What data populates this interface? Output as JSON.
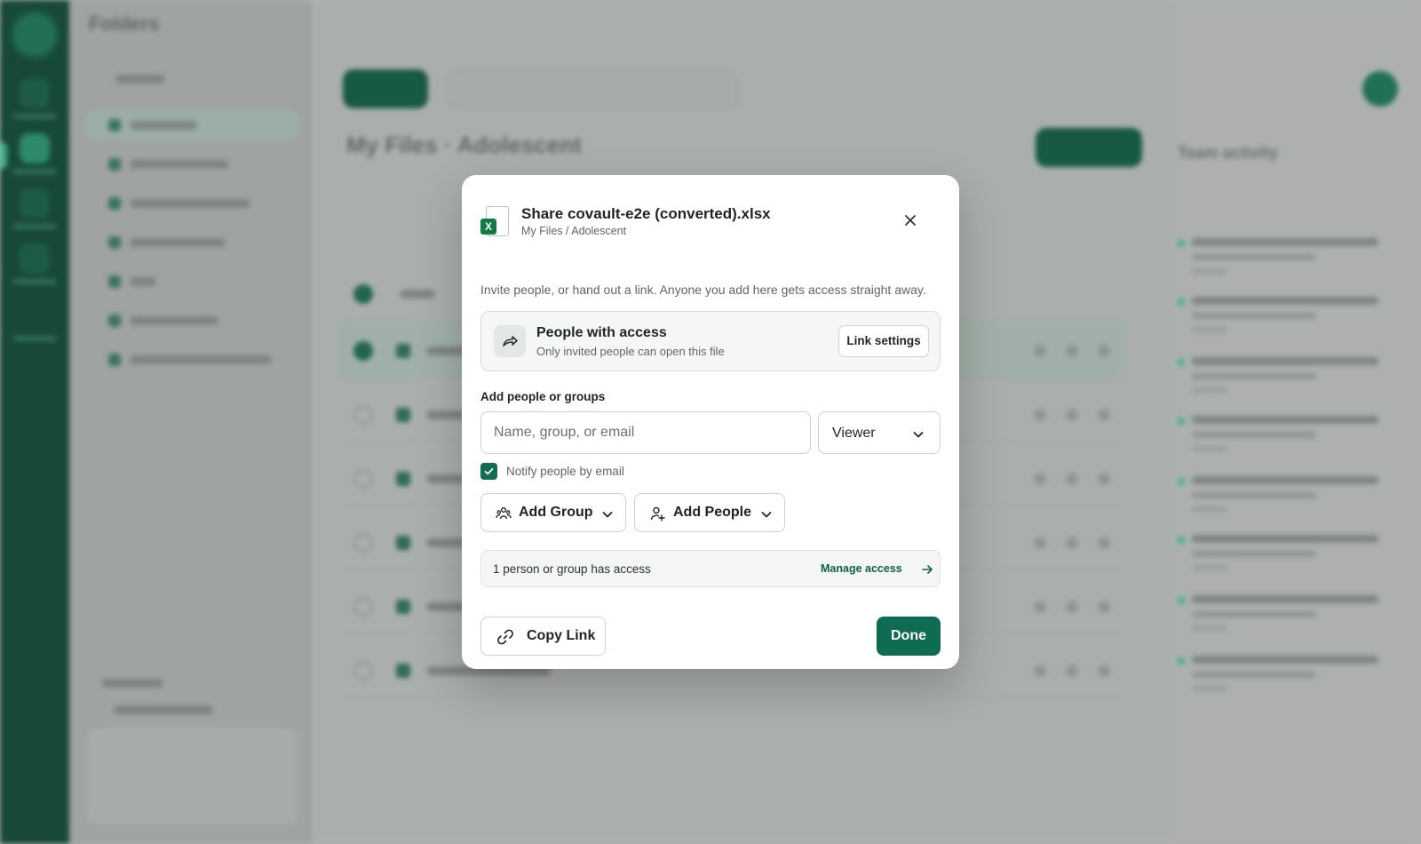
{
  "background": {
    "sidebar_title": "Folders",
    "page_title": "My Files · Adolescent",
    "activity_title": "Team activity"
  },
  "modal": {
    "file_icon_letter": "X",
    "title": "Share covault-e2e (converted).xlsx",
    "path": "My Files / Adolescent",
    "intro": "Invite people, or hand out a link. Anyone you add here gets access straight away.",
    "access_card": {
      "title": "People with access",
      "subtitle": "Only invited people can open this file",
      "link_settings_label": "Link settings"
    },
    "add_section_label": "Add people or groups",
    "name_input_placeholder": "Name, group, or email",
    "name_input_value": "",
    "role_selected": "Viewer",
    "notify_label": "Notify people by email",
    "notify_checked": true,
    "add_group_label": "Add Group",
    "add_people_label": "Add People",
    "access_count": "1 person or group has access",
    "manage_access_label": "Manage access",
    "copy_link_label": "Copy Link",
    "done_label": "Done"
  },
  "colors": {
    "brand": "#0f6b51",
    "excel": "#107c41"
  },
  "icons": [
    "excel-file-icon",
    "close-icon",
    "share-arrow-icon",
    "chevron-down-icon",
    "check-icon",
    "group-icon",
    "add-person-icon",
    "arrow-right-icon",
    "link-icon"
  ]
}
